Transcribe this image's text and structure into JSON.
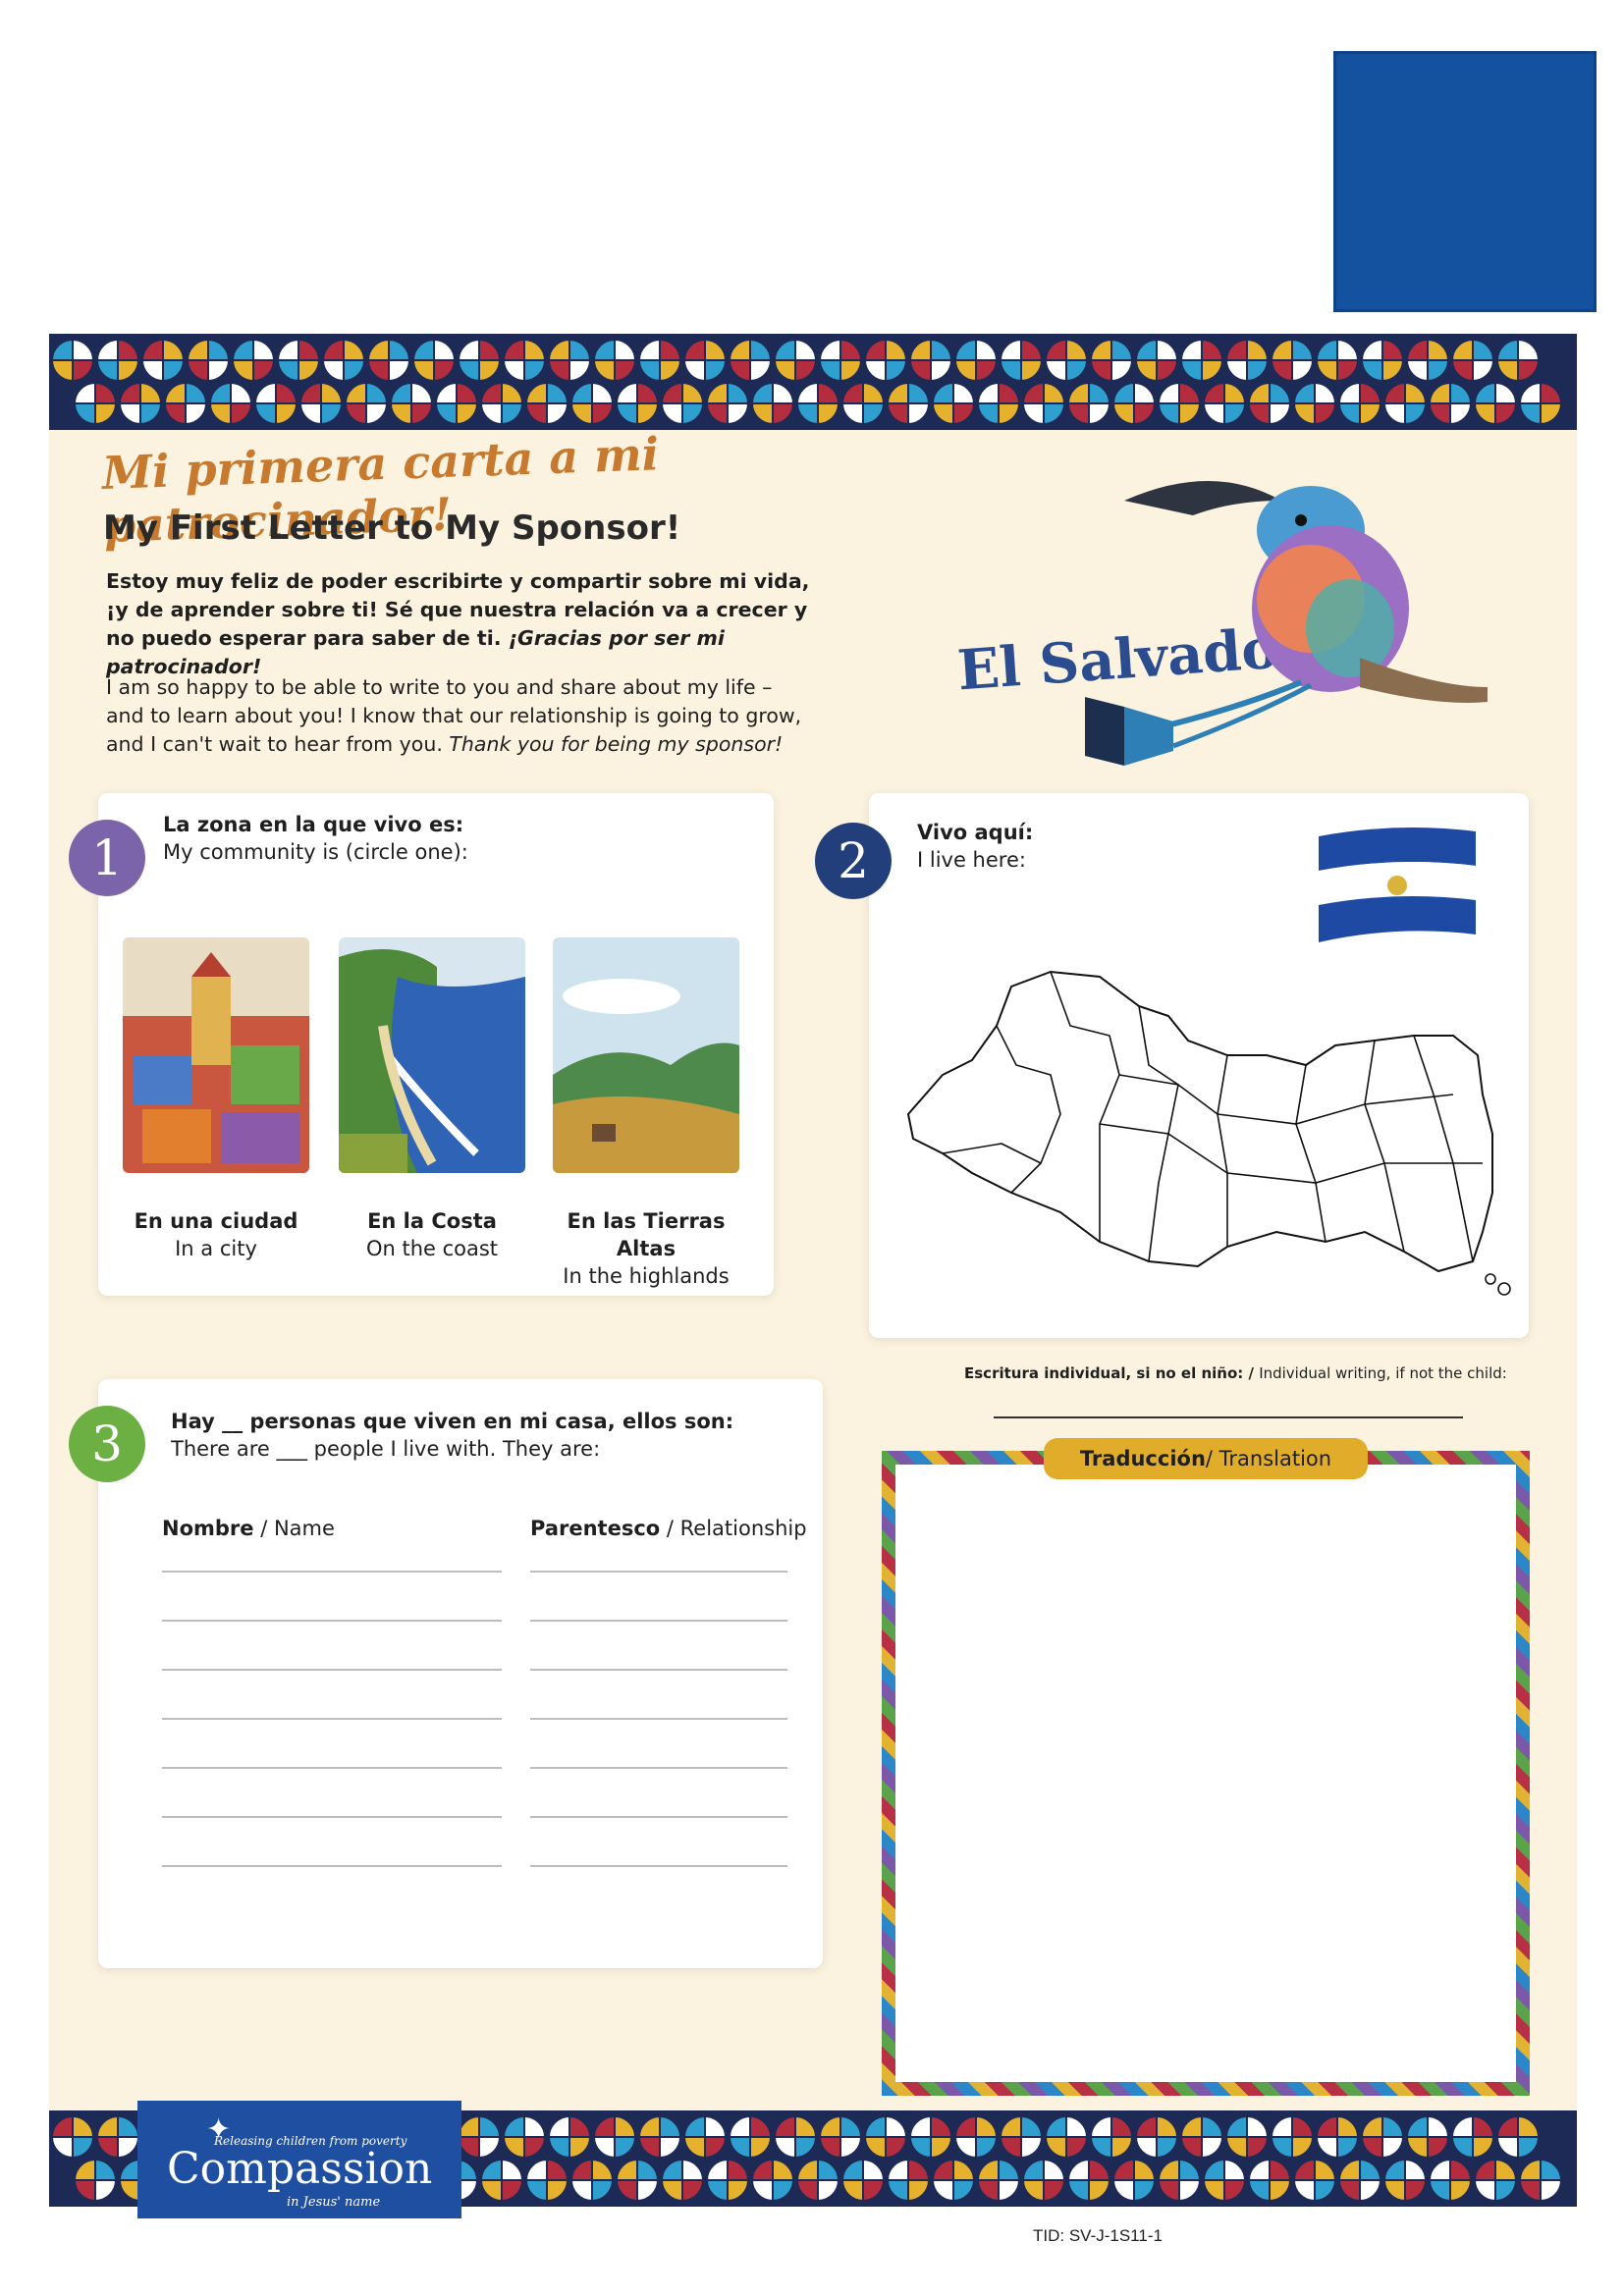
{
  "title_es": "Mi primera carta a mi patrocinador!",
  "title_en": "My First Letter to My Sponsor!",
  "intro_es_main": "Estoy muy feliz de poder escribirte y compartir sobre mi vida, ¡y de aprender sobre ti! Sé que nuestra relación va a crecer y no puedo esperar para saber de ti. ",
  "intro_es_em": "¡Gracias por ser mi patrocinador!",
  "intro_en_main": "I am so happy to be able to write to you and share about my life – and to learn about you! I know that our relationship is going to grow, and I can't wait to hear from you. ",
  "intro_en_em": "Thank you for being my sponsor!",
  "country": "El Salvador",
  "section1": {
    "number": "1",
    "question_es": "La zona en la que vivo es:",
    "question_en": "My community is (circle one):",
    "options": [
      {
        "es": "En una ciudad",
        "en": "In a city"
      },
      {
        "es": "En la Costa",
        "en": "On the coast"
      },
      {
        "es": "En las Tierras Altas",
        "en": "In the highlands"
      }
    ]
  },
  "section2": {
    "number": "2",
    "question_es": "Vivo aquí:",
    "question_en": "I live here:"
  },
  "section3": {
    "number": "3",
    "question_es": "Hay __ personas que viven en mi casa, ellos son:",
    "question_en": "There are ___ people I live with. They are:",
    "col1_es": "Nombre",
    "col1_en": " / Name",
    "col2_es": "Parentesco",
    "col2_en": " / Relationship"
  },
  "writer_es": "Escritura individual, si no el niño: / ",
  "writer_en": "Individual writing, if not the child:",
  "translation_es": "Traducción",
  "translation_en": " / Translation",
  "logo": {
    "tagline": "Releasing children from poverty",
    "name": "Compassion",
    "subline": "in Jesus' name"
  },
  "tid": "TID: SV-J-1S11-1",
  "colors": {
    "badge1": "#7b64a9",
    "badge2": "#233f7b",
    "badge3": "#6cb044",
    "brand_blue": "#1f4fa0",
    "title_orange": "#c77a2e"
  }
}
